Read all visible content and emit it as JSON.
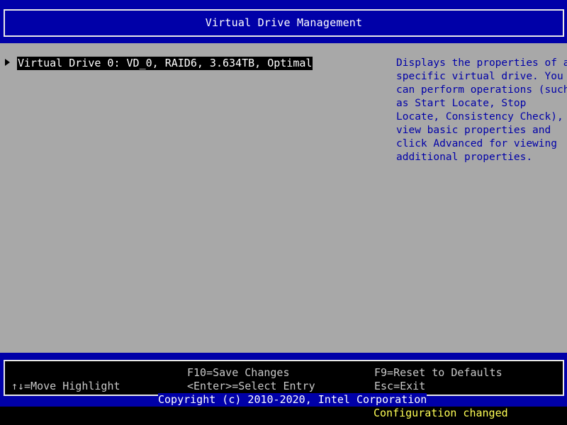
{
  "header": {
    "title": "Virtual Drive Management"
  },
  "main": {
    "items": [
      {
        "label": "Virtual Drive 0: VD_0, RAID6, 3.634TB, Optimal"
      }
    ],
    "help_lines": [
      "Displays the properties of a",
      "specific virtual drive. You",
      "can perform operations (such",
      "as Start Locate, Stop",
      "Locate, Consistency Check),",
      "view basic properties and",
      "click Advanced for viewing",
      "additional properties."
    ]
  },
  "footer": {
    "move_highlight": "↑↓=Move Highlight",
    "save_changes": "F10=Save Changes",
    "select_entry": "<Enter>=Select Entry",
    "reset_defaults": "F9=Reset to Defaults",
    "exit": "Esc=Exit",
    "copyright": "Copyright (c) 2010-2020, Intel Corporation",
    "status": "Configuration changed"
  },
  "colors": {
    "header_bg": "#0000a8",
    "main_bg": "#a8a8a8",
    "help_text": "#0000a8",
    "status_text": "#ffff55"
  }
}
